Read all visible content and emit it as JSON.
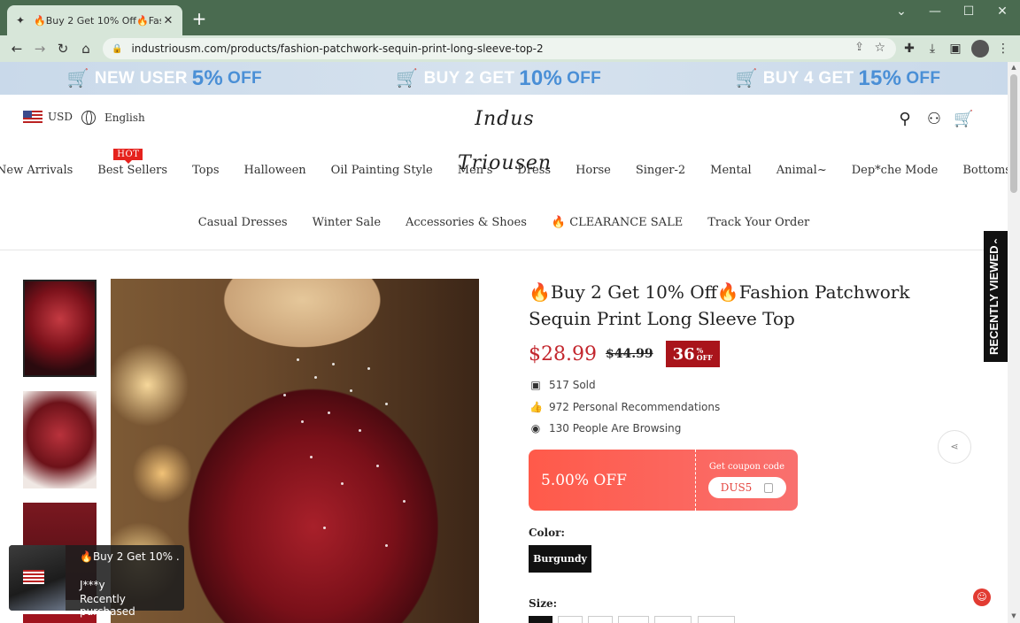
{
  "browser": {
    "tab_title": "🔥Buy 2 Get 10% Off🔥Fashion",
    "tab_close": "✕",
    "new_tab": "+",
    "url": "industriousm.com/products/fashion-patchwork-sequin-print-long-sleeve-top-2",
    "window_controls": [
      "⌄",
      "—",
      "☐",
      "✕"
    ]
  },
  "promo_bar": [
    {
      "prefix": "NEW USER",
      "big": "5%",
      "suffix": "OFF"
    },
    {
      "prefix": "BUY 2 GET",
      "big": "10%",
      "suffix": "OFF"
    },
    {
      "prefix": "BUY 4 GET",
      "big": "15%",
      "suffix": "OFF"
    }
  ],
  "header": {
    "currency": "USD",
    "language": "English",
    "logo_text": "Indus Triousen"
  },
  "menu_row1": [
    "New Arrivals",
    "Best Sellers",
    "Tops",
    "Halloween",
    "Oil Painting Style",
    "Men's",
    "Dress",
    "Horse",
    "Singer-2",
    "Mental",
    "Animal~",
    "Dep*che Mode",
    "Bottoms"
  ],
  "hot_badge": "HOT",
  "menu_row2": [
    "Casual Dresses",
    "Winter Sale",
    "Accessories & Shoes",
    "CLEARANCE SALE",
    "Track Your Order"
  ],
  "product": {
    "title": "🔥Buy 2 Get 10% Off🔥Fashion Patchwork Sequin Print Long Sleeve Top",
    "price": "$28.99",
    "compare_price": "$44.99",
    "discount_pct": "36",
    "discount_sym": "%",
    "discount_off": "OFF",
    "sold": "517 Sold",
    "recommendations": "972 Personal Recommendations",
    "browsing": "130 People Are Browsing",
    "coupon_off": "5.00% OFF",
    "coupon_label": "Get coupon code",
    "coupon_code": "DUS5",
    "color_label": "Color:",
    "color_value": "Burgundy",
    "size_label": "Size:"
  },
  "recently_viewed": "RECENTLY VIEWED",
  "toast": {
    "title": "🔥Buy 2 Get 10% ...",
    "buyer": "J***y",
    "action": "Recently purchased"
  }
}
